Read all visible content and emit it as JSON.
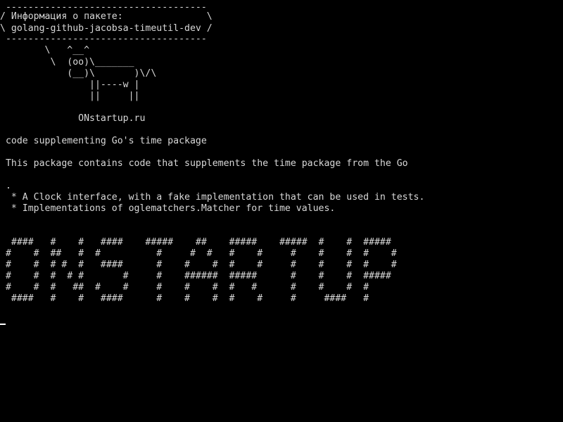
{
  "screen": {
    "background_color": "#000000",
    "text_color": "#d8d8d8",
    "cursor_color": "#ffffff"
  },
  "cowsay": {
    "top_border": " ------------------------------------",
    "bubble_line_1": "/ Информация о пакете:               \\",
    "bubble_line_2": "\\ golang-github-jacobsa-timeutil-dev /",
    "bottom_border": " ------------------------------------",
    "cow_line_1": "        \\   ^__^",
    "cow_line_2": "         \\  (oo)\\_______",
    "cow_line_3": "            (__)\\       )\\/\\",
    "cow_line_4": "                ||----w |",
    "cow_line_5": "                ||     ||"
  },
  "site": {
    "label": "              ONstartup.ru"
  },
  "package": {
    "summary": " code supplementing Go's time package",
    "description": " This package contains code that supplements the time package from the Go",
    "dot": " .",
    "bullet_1": "  * A Clock interface, with a fake implementation that can be used in tests.",
    "bullet_2": "  * Implementations of oglematchers.Matcher for time values."
  },
  "banner": {
    "row_1": "  ####   #    #   ####    #####    ##    #####    #####  #    #  #####",
    "row_2": " #    #  ##   #  #          #     #  #   #    #     #    #    #  #    #",
    "row_3": " #    #  # #  #   ####      #    #    #  #    #     #    #    #  #    #",
    "row_4": " #    #  #  # #       #     #    ######  #####      #    #    #  #####",
    "row_5": " #    #  #   ##  #    #     #    #    #  #   #      #    #    #  #",
    "row_6": "  ####   #    #   ####      #    #    #  #    #     #     ####   #"
  }
}
